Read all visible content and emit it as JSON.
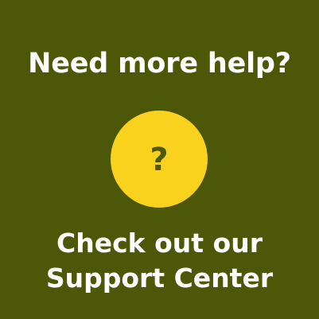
{
  "card": {
    "headline": "Need more help?",
    "icon": {
      "name": "question-mark-icon",
      "glyph": "?"
    },
    "cta_line1": "Check out our",
    "cta_line2": "Support Center"
  },
  "colors": {
    "background": "#4d5708",
    "accent": "#f8d21c",
    "text": "#ffffff"
  }
}
